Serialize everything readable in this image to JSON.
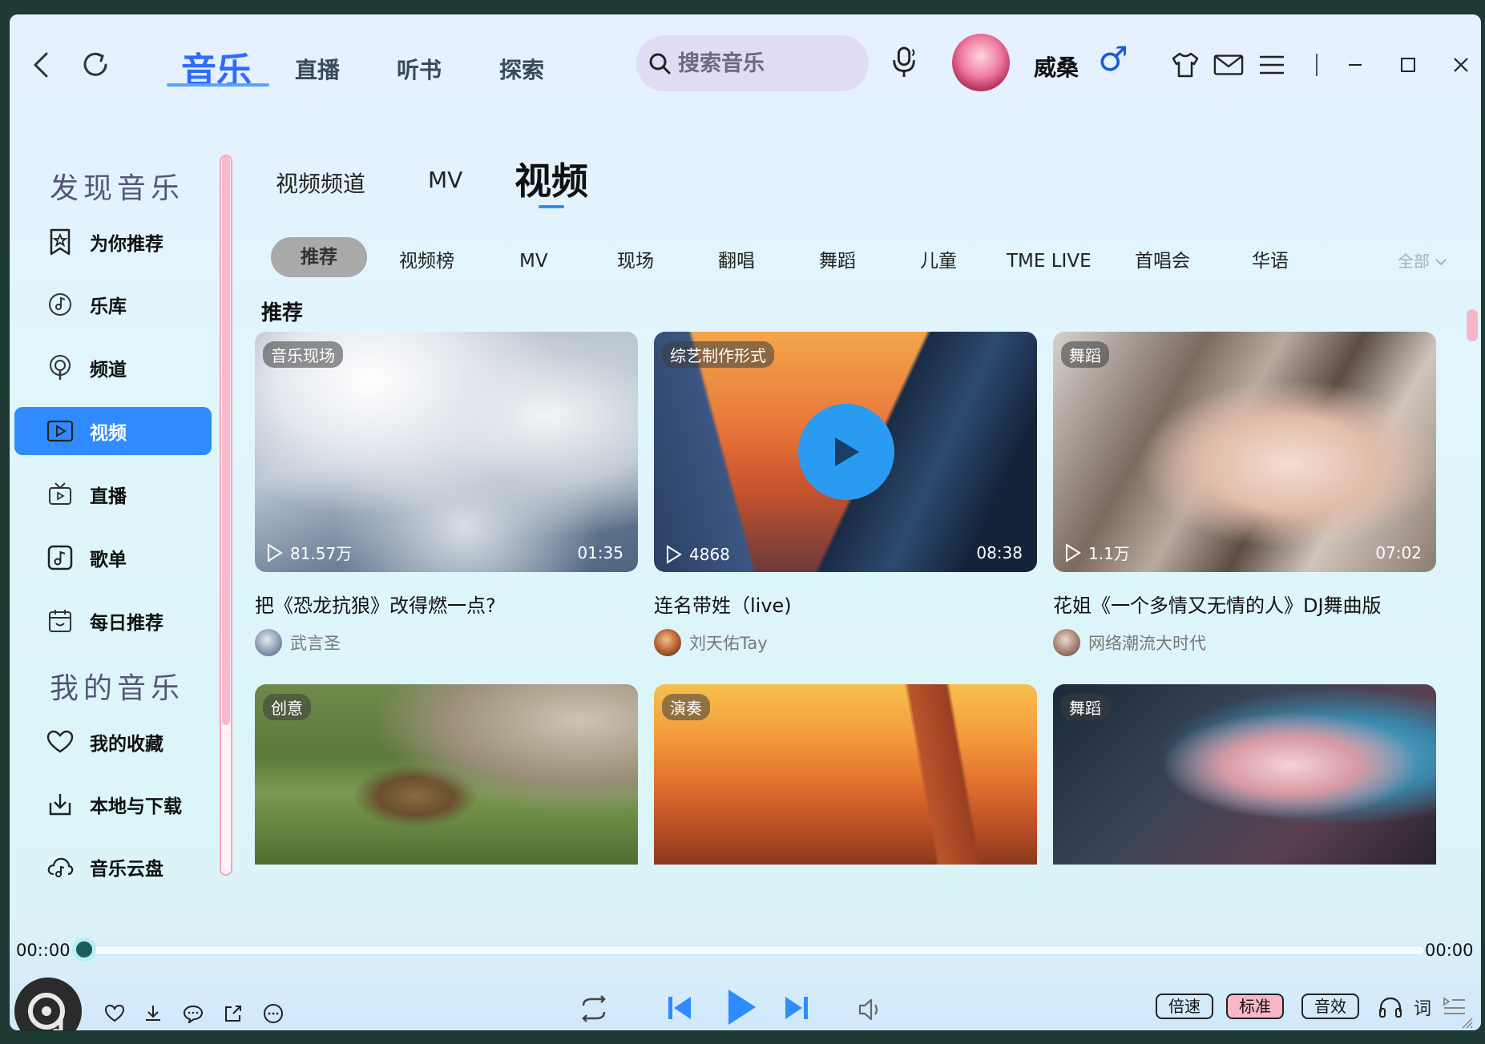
{
  "header": {
    "tabs": [
      {
        "label": "音乐",
        "active": true
      },
      {
        "label": "直播"
      },
      {
        "label": "听书"
      },
      {
        "label": "探索"
      }
    ],
    "search_placeholder": "搜索音乐",
    "username": "威桑",
    "gender_symbol": "♂"
  },
  "sidebar": {
    "section1": "发现音乐",
    "section2": "我的音乐",
    "items": [
      {
        "label": "为你推荐",
        "icon": "star-bookmark-icon"
      },
      {
        "label": "乐库",
        "icon": "music-disc-icon"
      },
      {
        "label": "频道",
        "icon": "broadcast-icon"
      },
      {
        "label": "视频",
        "icon": "video-play-icon",
        "active": true
      },
      {
        "label": "直播",
        "icon": "tv-icon"
      },
      {
        "label": "歌单",
        "icon": "note-icon"
      },
      {
        "label": "每日推荐",
        "icon": "calendar-icon"
      },
      {
        "label": "我的收藏",
        "icon": "heart-icon"
      },
      {
        "label": "本地与下载",
        "icon": "download-icon"
      },
      {
        "label": "音乐云盘",
        "icon": "cloud-music-icon"
      }
    ]
  },
  "content": {
    "subtabs": [
      {
        "label": "视频频道"
      },
      {
        "label": "MV"
      },
      {
        "label": "视频",
        "active": true
      }
    ],
    "categories": [
      "推荐",
      "视频榜",
      "MV",
      "现场",
      "翻唱",
      "舞蹈",
      "儿童",
      "TME LIVE",
      "首唱会",
      "华语"
    ],
    "all_label": "全部",
    "section_title": "推荐",
    "cards": [
      {
        "tag": "音乐现场",
        "views": "81.57万",
        "duration": "01:35",
        "title": "把《恐龙抗狼》改得燃一点?",
        "author": "武言圣"
      },
      {
        "tag": "综艺制作形式",
        "views": "4868",
        "duration": "08:38",
        "title": "连名带姓（live)",
        "author": "刘天佑Tay"
      },
      {
        "tag": "舞蹈",
        "views": "1.1万",
        "duration": "07:02",
        "title": "花姐《一个多情又无情的人》DJ舞曲版",
        "author": "网络潮流大时代"
      },
      {
        "tag": "创意"
      },
      {
        "tag": "演奏"
      },
      {
        "tag": "舞蹈"
      }
    ]
  },
  "player": {
    "time_current": "00::00",
    "time_total": "00:00",
    "speed": "倍速",
    "quality": "标准",
    "effect": "音效",
    "lyrics": "词",
    "progress": 0
  },
  "colors": {
    "accent": "#2f8bff",
    "brand_blue": "#2f6bff",
    "pink": "#f7b7c6"
  }
}
